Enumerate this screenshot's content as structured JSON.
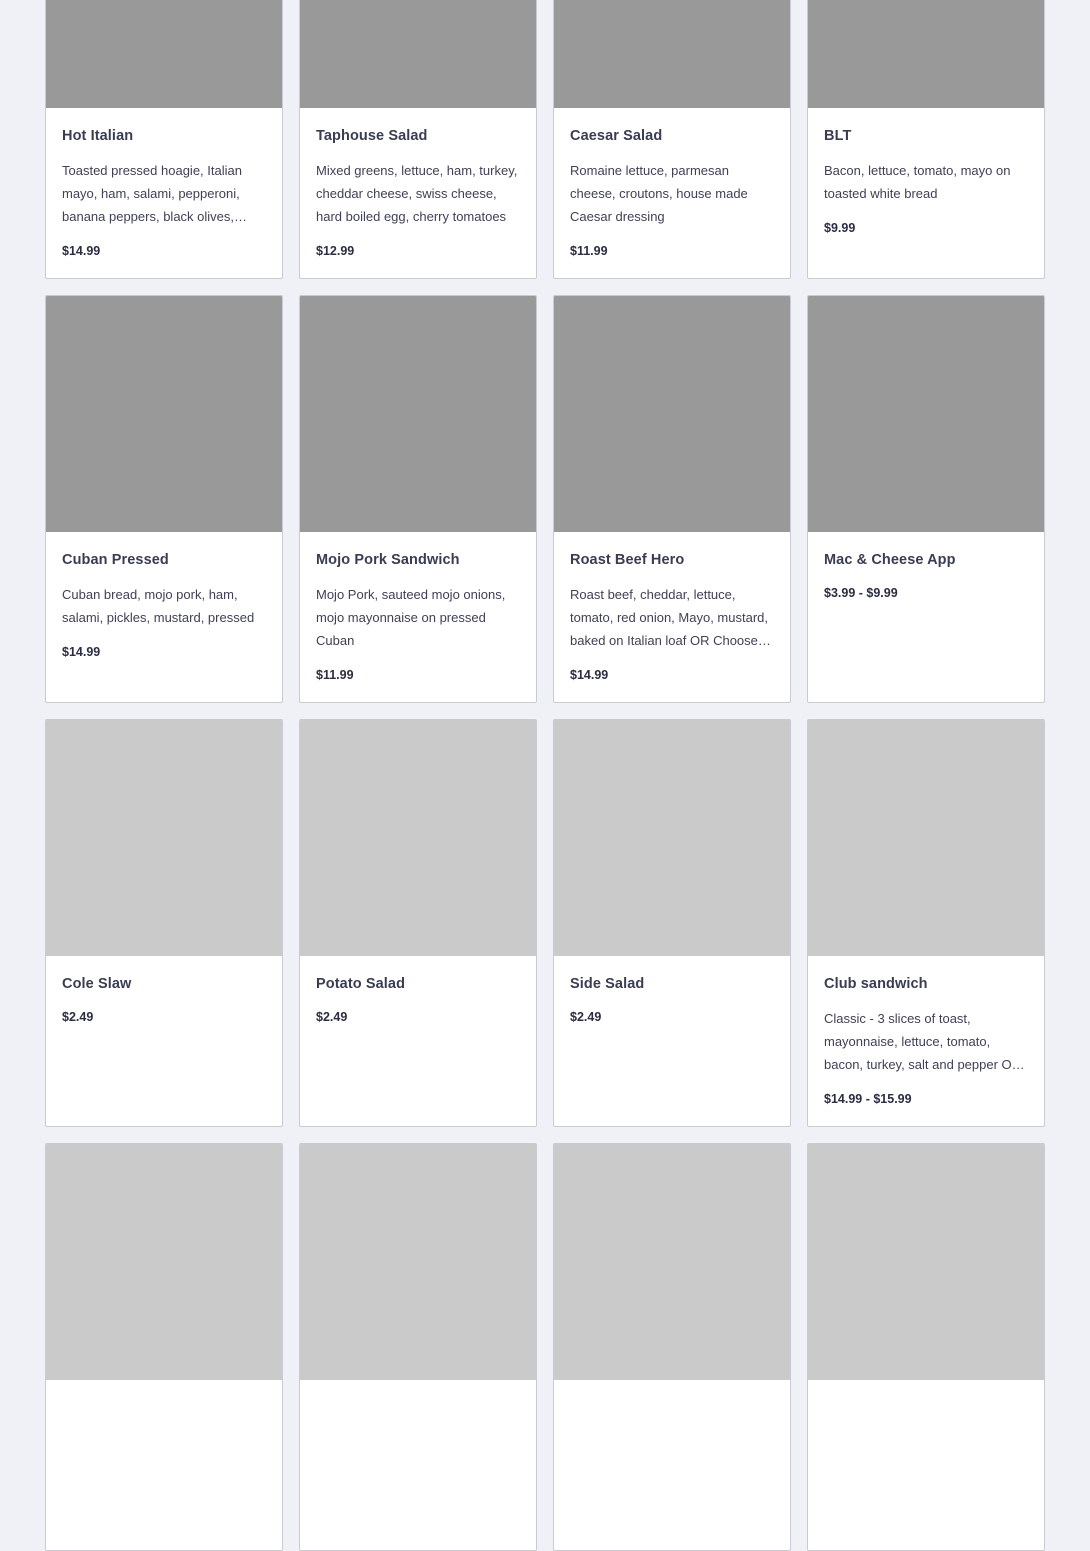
{
  "menu": {
    "items": [
      {
        "title": "Hot Italian",
        "description": "Toasted pressed hoagie, Italian mayo, ham, salami, pepperoni, banana peppers, black olives, provolone",
        "price": "$14.99",
        "image": "dark"
      },
      {
        "title": "Taphouse Salad",
        "description": "Mixed greens, lettuce, ham, turkey, cheddar cheese, swiss cheese, hard boiled egg, cherry tomatoes",
        "price": "$12.99",
        "image": "dark"
      },
      {
        "title": "Caesar Salad",
        "description": "Romaine lettuce, parmesan cheese, croutons, house made Caesar dressing",
        "price": "$11.99",
        "image": "dark"
      },
      {
        "title": "BLT",
        "description": "Bacon, lettuce, tomato, mayo on toasted white bread",
        "price": "$9.99",
        "image": "dark"
      },
      {
        "title": "Cuban Pressed",
        "description": "Cuban bread, mojo pork, ham, salami, pickles, mustard, pressed",
        "price": "$14.99",
        "image": "dark"
      },
      {
        "title": "Mojo Pork Sandwich",
        "description": "Mojo Pork, sauteed mojo onions, mojo mayonnaise on pressed Cuban",
        "price": "$11.99",
        "image": "dark"
      },
      {
        "title": "Roast Beef Hero",
        "description": "Roast beef, cheddar, lettuce, tomato, red onion, Mayo, mustard, baked on Italian loaf OR Choose a wrap",
        "price": "$14.99",
        "image": "dark"
      },
      {
        "title": "Mac & Cheese App",
        "description": "",
        "price": "$3.99 - $9.99",
        "image": "dark"
      },
      {
        "title": "Cole Slaw",
        "description": "",
        "price": "$2.49",
        "image": "light"
      },
      {
        "title": "Potato Salad",
        "description": "",
        "price": "$2.49",
        "image": "light"
      },
      {
        "title": "Side Salad",
        "description": "",
        "price": "$2.49",
        "image": "light"
      },
      {
        "title": "Club sandwich",
        "description": "Classic - 3 slices of toast, mayonnaise, lettuce, tomato, bacon, turkey, salt and pepper OR wrap",
        "price": "$14.99 - $15.99",
        "image": "light"
      },
      {
        "title": "",
        "description": "",
        "price": "",
        "image": "light"
      },
      {
        "title": "",
        "description": "",
        "price": "",
        "image": "light"
      },
      {
        "title": "",
        "description": "",
        "price": "",
        "image": "light"
      },
      {
        "title": "",
        "description": "",
        "price": "",
        "image": "light"
      }
    ]
  }
}
